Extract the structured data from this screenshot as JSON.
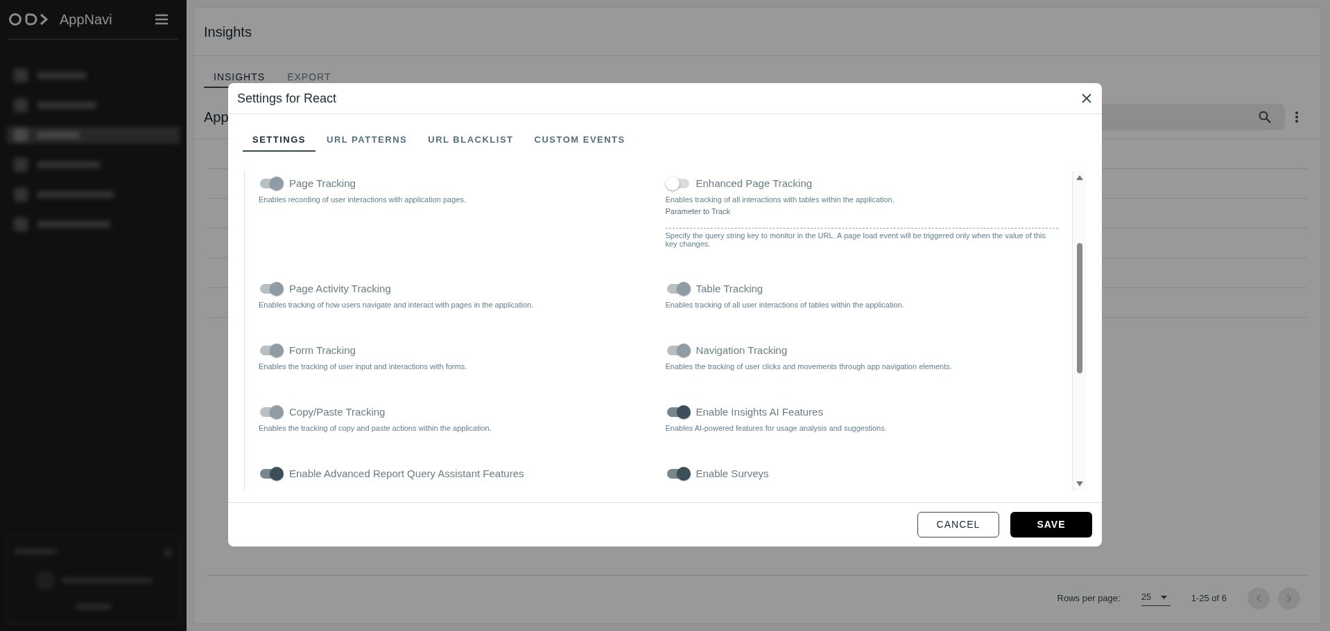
{
  "sidebar": {
    "app_name": "AppNavi"
  },
  "page": {
    "title": "Insights",
    "tabs": [
      {
        "label": "INSIGHTS",
        "selected": true
      },
      {
        "label": "EXPORT",
        "selected": false
      }
    ],
    "section_title": "App",
    "pagination": {
      "rows_label": "Rows per page:",
      "rows_value": "25",
      "range": "1-25 of 6"
    }
  },
  "dialog": {
    "title": "Settings for React",
    "tabs": [
      {
        "label": "SETTINGS",
        "selected": true
      },
      {
        "label": "URL PATTERNS",
        "selected": false
      },
      {
        "label": "URL BLACKLIST",
        "selected": false
      },
      {
        "label": "CUSTOM EVENTS",
        "selected": false
      }
    ],
    "settings": [
      {
        "label": "Page Tracking",
        "description": "Enables recording of user interactions with application pages.",
        "on": true,
        "disabled": true
      },
      {
        "label": "Enhanced Page Tracking",
        "description": "Enables tracking of all interactions with tables within the application.",
        "on": false,
        "disabled": false,
        "parameter": {
          "label": "Parameter to Track",
          "helper": "Specify the query string key to monitor in the URL. A page load event will be triggered only when the value of this key changes."
        }
      },
      {
        "label": "Page Activity Tracking",
        "description": "Enables tracking of how users navigate and interact with pages in the application.",
        "on": true,
        "disabled": true
      },
      {
        "label": "Table Tracking",
        "description": "Enables tracking of all user interactions of tables within the application.",
        "on": true,
        "disabled": true
      },
      {
        "label": "Form Tracking",
        "description": "Enables the tracking of user input and interactions with forms.",
        "on": true,
        "disabled": true
      },
      {
        "label": "Navigation Tracking",
        "description": "Enables the tracking of user clicks and movements through app navigation elements.",
        "on": true,
        "disabled": true
      },
      {
        "label": "Copy/Paste Tracking",
        "description": "Enables the tracking of copy and paste actions within the application.",
        "on": true,
        "disabled": true
      },
      {
        "label": "Enable Insights AI Features",
        "description": "Enables AI-powered features for usage analysis and suggestions.",
        "on": true,
        "disabled": false
      },
      {
        "label": "Enable Advanced Report Query Assistant Features",
        "on": true,
        "disabled": false
      },
      {
        "label": "Enable Surveys",
        "on": true,
        "disabled": false
      }
    ],
    "buttons": [
      {
        "label": "CANCEL",
        "kind": "secondary"
      },
      {
        "label": "SAVE",
        "kind": "primary"
      }
    ]
  }
}
